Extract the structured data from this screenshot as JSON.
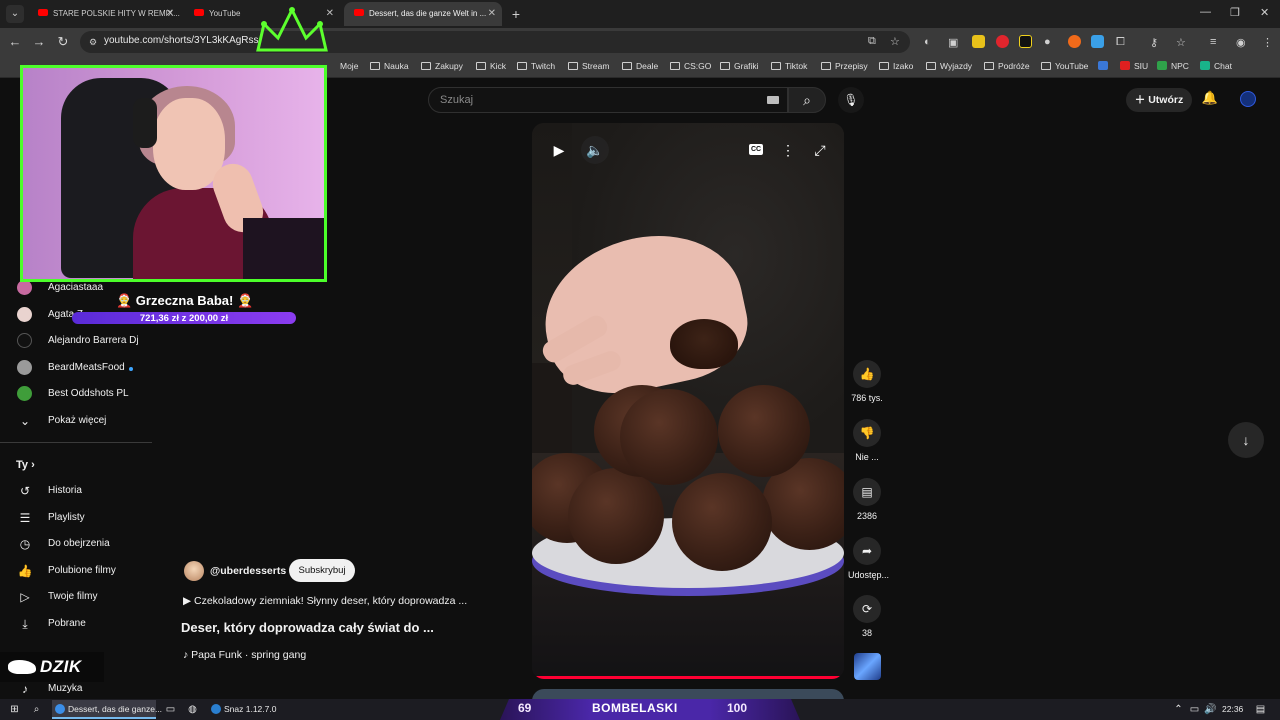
{
  "browser": {
    "tabs": [
      {
        "label": "STARE POLSKIE HITY W REMIX..."
      },
      {
        "label": "YouTube"
      },
      {
        "label": "Dessert, das die ganze Welt in ..."
      }
    ],
    "new_tab": "+",
    "url": "youtube.com/shorts/3YL3kKAgRss",
    "bookmarks": [
      "Moje",
      "Nauka",
      "Zakupy",
      "Kick",
      "Twitch",
      "Stream",
      "Deale",
      "CS:GO",
      "Grafiki",
      "Tiktok",
      "Przepisy",
      "Izako",
      "Wyjazdy",
      "Podróże",
      "YouTube",
      "SIU",
      "NPC",
      "Chat"
    ]
  },
  "youtube": {
    "search_placeholder": "Szukaj",
    "create_label": "Utwórz",
    "sidebar": {
      "subscriptions": [
        {
          "name": "Agaciastaaa"
        },
        {
          "name": "Agata Z..."
        },
        {
          "name": "Alejandro Barrera Dj"
        },
        {
          "name": "BeardMeatsFood"
        },
        {
          "name": "Best Oddshots PL"
        }
      ],
      "show_more": "Pokaż więcej",
      "you_header": "Ty",
      "you_items": [
        {
          "label": "Historia",
          "icon": "history-icon"
        },
        {
          "label": "Playlisty",
          "icon": "playlist-icon"
        },
        {
          "label": "Do obejrzenia",
          "icon": "clock-icon"
        },
        {
          "label": "Polubione filmy",
          "icon": "thumbs-up-icon"
        },
        {
          "label": "Twoje filmy",
          "icon": "video-icon"
        },
        {
          "label": "Pobrane",
          "icon": "download-icon"
        }
      ],
      "music": "Muzyka"
    },
    "short": {
      "channel": "@uberdesserts",
      "subscribe": "Subskrybuj",
      "description": "▶ Czekoladowy ziemniak! Słynny deser, który doprowadza ...",
      "title": "Deser, który doprowadza cały świat do ...",
      "music": "♪ Papa Funk · spring gang",
      "actions": {
        "likes": "786 tys.",
        "dislike": "Nie ...",
        "comments": "2386",
        "share": "Udostęp...",
        "remix": "38"
      },
      "cc": "CC"
    }
  },
  "overlay": {
    "donation_title": "🤶 Grzeczna Baba! 🤶",
    "goal_text": "721,36 zł z 200,00 zł",
    "goal_fraction": 1.0,
    "brand": "DZIK",
    "strip_left": "69",
    "strip_word": "BOMBELASKI",
    "strip_right": "100"
  },
  "taskbar": {
    "apps": [
      {
        "label": "Dessert, das die ganze..."
      },
      {
        "label": "Snaz 1.12.7.0"
      }
    ],
    "time": "22:36"
  },
  "colors": {
    "cam_border": "#4cff2a",
    "goal_bar": "#6b2ad6",
    "yt_red": "#ff0000"
  }
}
